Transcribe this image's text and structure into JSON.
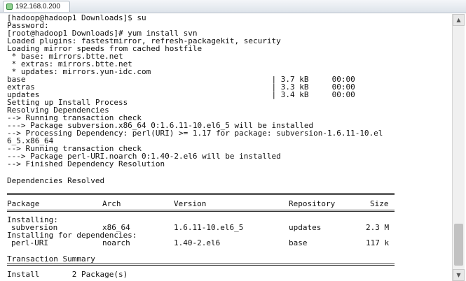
{
  "tab": {
    "title": "192.168.0.200",
    "icon": "session-icon"
  },
  "terminal": {
    "lines": [
      "[hadoop@hadoop1 Downloads]$ su",
      "Password:",
      "[root@hadoop1 Downloads]# yum install svn",
      "Loaded plugins: fastestmirror, refresh-packagekit, security",
      "Loading mirror speeds from cached hostfile",
      " * base: mirrors.btte.net",
      " * extras: mirrors.btte.net",
      " * updates: mirrors.yun-idc.com",
      "base                                                     | 3.7 kB     00:00",
      "extras                                                   | 3.3 kB     00:00",
      "updates                                                  | 3.4 kB     00:00",
      "Setting up Install Process",
      "Resolving Dependencies",
      "--> Running transaction check",
      "---> Package subversion.x86_64 0:1.6.11-10.el6_5 will be installed",
      "--> Processing Dependency: perl(URI) >= 1.17 for package: subversion-1.6.11-10.el",
      "6_5.x86_64",
      "--> Running transaction check",
      "---> Package perl-URI.noarch 0:1.40-2.el6 will be installed",
      "--> Finished Dependency Resolution",
      "",
      "Dependencies Resolved"
    ],
    "table": {
      "headers": [
        "Package",
        "Arch",
        "Version",
        "Repository",
        "Size"
      ],
      "installing_label": "Installing:",
      "rows_main": [
        [
          "subversion",
          "x86_64",
          "1.6.11-10.el6_5",
          "updates",
          "2.3 M"
        ]
      ],
      "deps_label": "Installing for dependencies:",
      "rows_deps": [
        [
          "perl-URI",
          "noarch",
          "1.40-2.el6",
          "base",
          "117 k"
        ]
      ]
    },
    "summary_title": "Transaction Summary",
    "install_line": "Install       2 Package(s)"
  },
  "scrollbar": {
    "up": "▲",
    "down": "▼"
  }
}
